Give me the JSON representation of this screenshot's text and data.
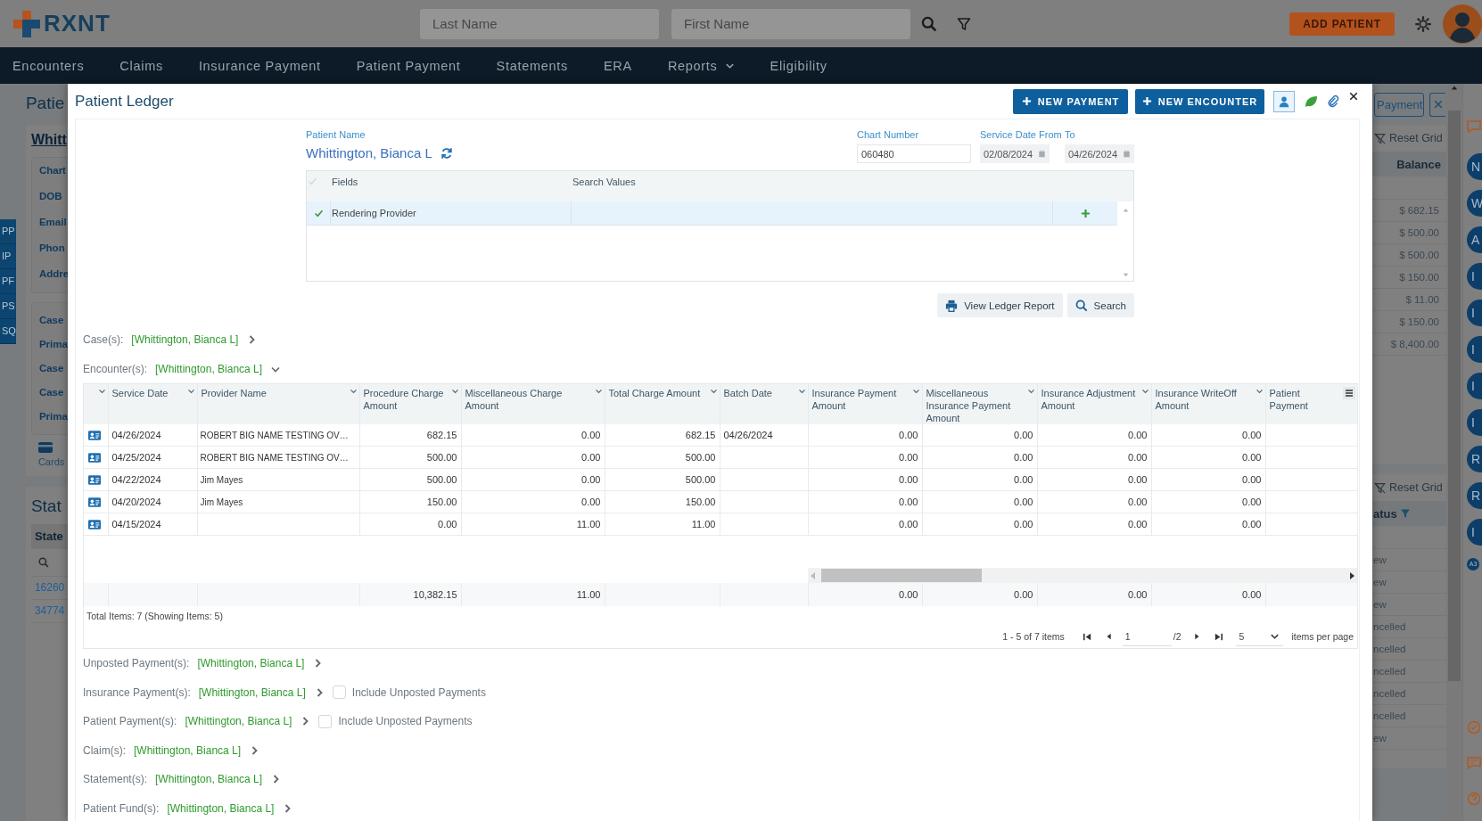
{
  "header": {
    "logo": "RXNT",
    "search_fields": [
      {
        "placeholder": "Last Name"
      },
      {
        "placeholder": "First Name"
      }
    ],
    "add_patient_button": "ADD PATIENT"
  },
  "nav": [
    {
      "label": "Encounters",
      "has_menu": false
    },
    {
      "label": "Claims",
      "has_menu": false
    },
    {
      "label": "Insurance Payment",
      "has_menu": false
    },
    {
      "label": "Patient Payment",
      "has_menu": false
    },
    {
      "label": "Statements",
      "has_menu": false
    },
    {
      "label": "ERA",
      "has_menu": false
    },
    {
      "label": "Reports",
      "has_menu": true
    },
    {
      "label": "Eligibility",
      "has_menu": false
    }
  ],
  "background_left": {
    "title": "Patie",
    "patient_link": "Whitt",
    "info_labels": [
      "Chart",
      "DOB",
      "Email",
      "Phon",
      "Addre"
    ],
    "case_labels": [
      "Case",
      "Prima",
      "Case",
      "Case",
      "Prima"
    ],
    "cards_label": "Cards",
    "side_tabs": [
      "PP",
      "IP",
      "PF",
      "PS",
      "SQ"
    ],
    "statements_title": "Stat",
    "statements_column": "State",
    "statement_links": [
      "16260",
      "34774"
    ]
  },
  "background_right": {
    "payment_button": "Payment",
    "balances_grid": {
      "reset_label": "Reset Grid",
      "column": "Balance",
      "rows": [
        "$ 682.15",
        "$ 500.00",
        "$ 500.00",
        "$ 150.00",
        "$ 11.00",
        "$ 150.00",
        "$ 8,400.00"
      ]
    },
    "status_grid": {
      "reset_label": "Reset Grid",
      "column": "atus",
      "rows": [
        "ew",
        "ew",
        "ew",
        "ncelled",
        "ncelled",
        "ncelled",
        "ncelled",
        "ncelled",
        "ew"
      ]
    },
    "rail_badges": [
      "N",
      "W",
      "A",
      "I",
      "I",
      "I",
      "I",
      "I",
      "R",
      "R",
      "I"
    ],
    "small_badge": "A3"
  },
  "modal": {
    "title": "Patient Ledger",
    "buttons": [
      "NEW PAYMENT",
      "NEW ENCOUNTER"
    ],
    "patient_name": {
      "label": "Patient Name",
      "value": "Whittington, Bianca L"
    },
    "chart_number": {
      "label": "Chart Number",
      "value": "060480"
    },
    "service_date_from": {
      "label": "Service Date From",
      "value": "02/08/2024"
    },
    "service_date_to": {
      "label": "To",
      "value": "04/26/2024"
    },
    "filter_grid": {
      "all_checked": false,
      "columns": [
        "Fields",
        "Search Values"
      ],
      "rows": [
        {
          "field": "Rendering Provider",
          "checked": true,
          "selected": true
        }
      ]
    },
    "actions": [
      "View Ledger Report",
      "Search"
    ],
    "case_section": {
      "label": "Case(s):",
      "value": "[Whittington, Bianca L]",
      "expanded": false
    },
    "encounter_section": {
      "label": "Encounter(s):",
      "value": "[Whittington, Bianca L]",
      "expanded": true
    },
    "encounters_table": {
      "columns": [
        {
          "label": "Service Date"
        },
        {
          "label": "Provider Name"
        },
        {
          "label": "Procedure Charge Amount",
          "total": "10,382.15"
        },
        {
          "label": "Miscellaneous Charge Amount",
          "total": "11.00"
        },
        {
          "label": "Total Charge Amount"
        },
        {
          "label": "Batch Date"
        },
        {
          "label": "Insurance Payment Amount",
          "total": "0.00"
        },
        {
          "label": "Miscellaneous Insurance Payment Amount",
          "total": "0.00"
        },
        {
          "label": "Insurance Adjustment Amount",
          "total": "0.00"
        },
        {
          "label": "Insurance WriteOff Amount",
          "total": "0.00"
        },
        {
          "label": "Patient Payment"
        }
      ],
      "rows": [
        {
          "service_date": "04/26/2024",
          "provider_name": "ROBERT BIG NAME TESTING OV…",
          "procedure_charge": "682.15",
          "miscellaneous_charge": "0.00",
          "total_charge": "682.15",
          "batch_date": "04/26/2024",
          "insurance_payment": "0.00",
          "miscellaneous_insurance_payment": "0.00",
          "insurance_adjustment": "0.00",
          "insurance_writeoff": "0.00"
        },
        {
          "service_date": "04/25/2024",
          "provider_name": "ROBERT BIG NAME TESTING OV…",
          "procedure_charge": "500.00",
          "miscellaneous_charge": "0.00",
          "total_charge": "500.00",
          "insurance_payment": "0.00",
          "miscellaneous_insurance_payment": "0.00",
          "insurance_adjustment": "0.00",
          "insurance_writeoff": "0.00"
        },
        {
          "service_date": "04/22/2024",
          "provider_name": "Jim Mayes",
          "procedure_charge": "500.00",
          "miscellaneous_charge": "0.00",
          "total_charge": "500.00",
          "insurance_payment": "0.00",
          "miscellaneous_insurance_payment": "0.00",
          "insurance_adjustment": "0.00",
          "insurance_writeoff": "0.00"
        },
        {
          "service_date": "04/20/2024",
          "provider_name": "Jim Mayes",
          "procedure_charge": "150.00",
          "miscellaneous_charge": "0.00",
          "total_charge": "150.00",
          "insurance_payment": "0.00",
          "miscellaneous_insurance_payment": "0.00",
          "insurance_adjustment": "0.00",
          "insurance_writeoff": "0.00"
        },
        {
          "service_date": "04/15/2024",
          "procedure_charge": "0.00",
          "miscellaneous_charge": "11.00",
          "total_charge": "11.00",
          "insurance_payment": "0.00",
          "miscellaneous_insurance_payment": "0.00",
          "insurance_adjustment": "0.00",
          "insurance_writeoff": "0.00"
        }
      ],
      "total_items": "Total Items: 7 (Showing Items: 5)",
      "pagination": {
        "summary": "1 - 5 of 7 items",
        "page": "1",
        "page_count": "/2",
        "page_size": "5",
        "page_size_label": "items per page"
      }
    },
    "sections": [
      {
        "label": "Unposted Payment(s):",
        "value": "[Whittington, Bianca L]",
        "expanded": false
      },
      {
        "label": "Insurance Payment(s):",
        "value": "[Whittington, Bianca L]",
        "expanded": false,
        "option": {
          "label": "Include Unposted Payments",
          "checked": false
        }
      },
      {
        "label": "Patient Payment(s):",
        "value": "[Whittington, Bianca L]",
        "expanded": false,
        "option": {
          "label": "Include Unposted Payments",
          "checked": false
        }
      },
      {
        "label": "Claim(s):",
        "value": "[Whittington, Bianca L]",
        "expanded": false
      },
      {
        "label": "Statement(s):",
        "value": "[Whittington, Bianca L]",
        "expanded": false
      },
      {
        "label": "Patient Fund(s):",
        "value": "[Whittington, Bianca L]",
        "expanded": false
      }
    ]
  }
}
